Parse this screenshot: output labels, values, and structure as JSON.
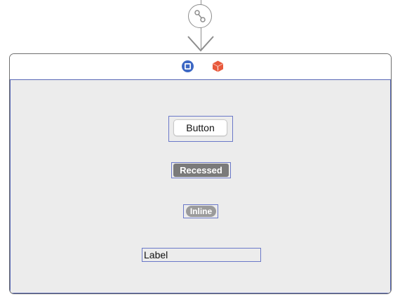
{
  "segue": {
    "icon": "segue-link-icon"
  },
  "scene": {
    "dock_icons": [
      "view-controller-icon",
      "first-responder-icon"
    ],
    "colors": {
      "view_controller_icon": "#3d68c4",
      "first_responder_icon": "#e8593c",
      "selection_outline": "#5767b5",
      "view_background": "#ececec"
    }
  },
  "controls": {
    "push_button_label": "Button",
    "recessed_button_label": "Recessed",
    "inline_button_label": "Inline",
    "label_text": "Label"
  }
}
